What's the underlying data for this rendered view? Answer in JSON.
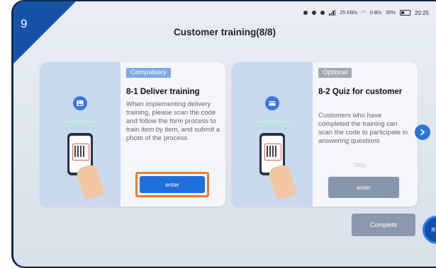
{
  "step_number": "9",
  "status_bar": {
    "network_speed": "25 KB/s",
    "wifi_speed": "0 B/s",
    "battery": "35%",
    "time": "20:25"
  },
  "title": "Customer training(8/8)",
  "cards": [
    {
      "tag": "Compulsory",
      "title": "8-1  Deliver training",
      "description": "When implementing delivery training, please scan the code and follow the form process to train item by item, and submit a photo of the process",
      "button_label": "enter",
      "icon": "image-icon"
    },
    {
      "tag": "Optional",
      "title": "8-2  Quiz for customer",
      "description": "Customers who have completed the training can scan the code to participate in answering questions",
      "skip_label": "Skip",
      "button_label": "enter",
      "icon": "card-icon"
    }
  ],
  "complete_label": "Complete",
  "fab_label": "≡",
  "colors": {
    "accent": "#1e6fd9",
    "highlight": "#ef7b2c",
    "corner": "#1553a6"
  }
}
